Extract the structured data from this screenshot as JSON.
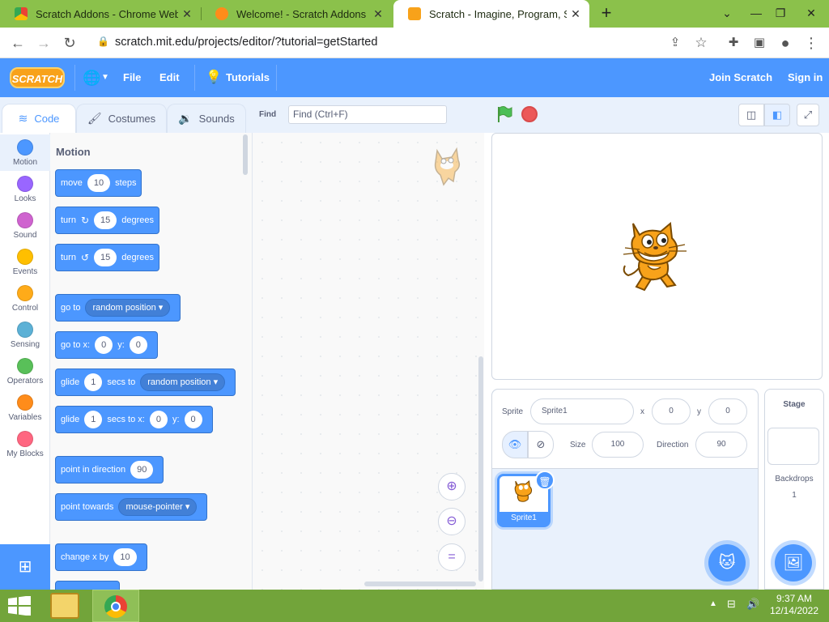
{
  "browser": {
    "tabs": [
      {
        "title": "Scratch Addons - Chrome Web Store"
      },
      {
        "title": "Welcome! - Scratch Addons"
      },
      {
        "title": "Scratch - Imagine, Program, Share"
      }
    ],
    "new_tab_label": "+",
    "url": "scratch.mit.edu/projects/editor/?tutorial=getStarted"
  },
  "menubar": {
    "logo": "SCRATCH",
    "file": "File",
    "edit": "Edit",
    "tutorials": "Tutorials",
    "join": "Join Scratch",
    "signin": "Sign in"
  },
  "editor_tabs": [
    {
      "label": "Code"
    },
    {
      "label": "Costumes"
    },
    {
      "label": "Sounds"
    }
  ],
  "find": {
    "label": "Find",
    "placeholder": "Find (Ctrl+F)"
  },
  "categories": [
    {
      "label": "Motion",
      "color": "#4c97ff"
    },
    {
      "label": "Looks",
      "color": "#9966ff"
    },
    {
      "label": "Sound",
      "color": "#cf63cf"
    },
    {
      "label": "Events",
      "color": "#ffbf00"
    },
    {
      "label": "Control",
      "color": "#ffab19"
    },
    {
      "label": "Sensing",
      "color": "#5cb1d6"
    },
    {
      "label": "Operators",
      "color": "#59c059"
    },
    {
      "label": "Variables",
      "color": "#ff8c1a"
    },
    {
      "label": "My Blocks",
      "color": "#ff6680"
    }
  ],
  "palette": {
    "heading": "Motion",
    "blocks": {
      "move": {
        "t1": "move",
        "v1": "10",
        "t2": "steps"
      },
      "turn_right": {
        "t1": "turn",
        "v1": "15",
        "t2": "degrees"
      },
      "turn_left": {
        "t1": "turn",
        "v1": "15",
        "t2": "degrees"
      },
      "goto": {
        "t1": "go to",
        "d1": "random position"
      },
      "gotoxy": {
        "t1": "go to x:",
        "v1": "0",
        "t2": "y:",
        "v2": "0"
      },
      "glide_to": {
        "t1": "glide",
        "v1": "1",
        "t2": "secs to",
        "d1": "random position"
      },
      "glide_xy": {
        "t1": "glide",
        "v1": "1",
        "t2": "secs to x:",
        "v2": "0",
        "t3": "y:",
        "v3": "0"
      },
      "point_dir": {
        "t1": "point in direction",
        "v1": "90"
      },
      "point_towards": {
        "t1": "point towards",
        "d1": "mouse-pointer"
      },
      "change_x": {
        "t1": "change x by",
        "v1": "10"
      }
    }
  },
  "sprite": {
    "label": "Sprite",
    "name": "Sprite1",
    "x_label": "x",
    "x": "0",
    "y_label": "y",
    "y": "0",
    "size_label": "Size",
    "size": "100",
    "direction_label": "Direction",
    "direction": "90",
    "tile_name": "Sprite1"
  },
  "stage_pane": {
    "label": "Stage",
    "backdrops_label": "Backdrops",
    "backdrops_count": "1"
  },
  "clock": {
    "time": "9:37 AM",
    "date": "12/14/2022"
  }
}
